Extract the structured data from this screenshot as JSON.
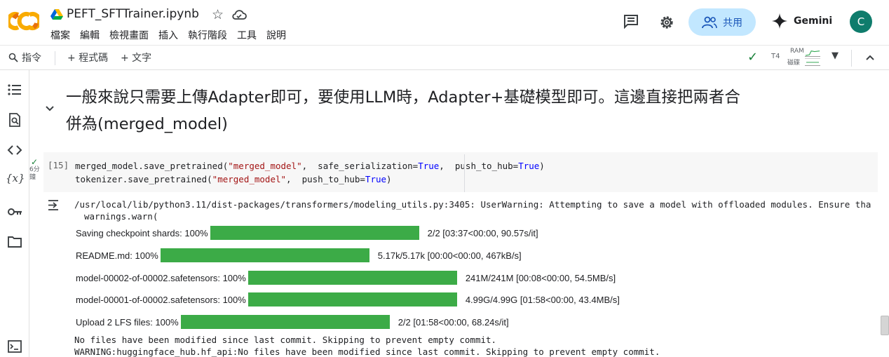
{
  "header": {
    "title": "PEFT_SFTTrainer.ipynb",
    "menu": [
      "檔案",
      "編輯",
      "檢視畫面",
      "插入",
      "執行階段",
      "工具",
      "說明"
    ],
    "share_label": "共用",
    "gemini_label": "Gemini",
    "avatar_letter": "C",
    "colors": {
      "accent": "#c2e7ff",
      "avatar": "#0f7c6c"
    }
  },
  "toolbar": {
    "commands_label": "指令",
    "code_label": "+ 程式碼",
    "text_label": "+ 文字",
    "runtime_type": "T4",
    "ram_label": "RAM",
    "disk_label": "磁碟"
  },
  "sidebar": {
    "icons": [
      "table-of-contents-icon",
      "find-replace-icon",
      "code-snippets-icon",
      "variables-icon",
      "secrets-key-icon",
      "files-folder-icon",
      "terminal-icon"
    ],
    "variables_glyph": "{x}"
  },
  "markdown": {
    "heading": "一般來說只需要上傳Adapter即可，要使用LLM時，Adapter+基礎模型即可。這邊直接把兩者合併為(merged_model)"
  },
  "cell": {
    "exec_count": "[15]",
    "exec_time": "6分鐘",
    "code": {
      "line1": [
        "merged_model.save_pretrained(",
        "\"merged_model\"",
        ",  safe_serialization=",
        "True",
        ",  push_to_hub=",
        "True",
        ")"
      ],
      "line2": [
        "tokenizer.save_pretrained(",
        "\"merged_model\"",
        ",  push_to_hub=",
        "True",
        ")"
      ]
    }
  },
  "output": {
    "warning_line": "/usr/local/lib/python3.11/dist-packages/transformers/modeling_utils.py:3405: UserWarning: Attempting to save a model with offloaded modules. Ensure tha",
    "warning_line2": "warnings.warn(",
    "progress": [
      {
        "label": "Saving checkpoint shards: 100%",
        "fraction": 1.0,
        "stats": "2/2  [03:37<00:00,  90.57s/it]"
      },
      {
        "label": "README.md: 100%",
        "fraction": 1.0,
        "stats": "5.17k/5.17k  [00:00<00:00,  467kB/s]"
      },
      {
        "label": "model-00002-of-00002.safetensors: 100%",
        "fraction": 1.0,
        "stats": "241M/241M  [00:08<00:00,  54.5MB/s]"
      },
      {
        "label": "model-00001-of-00002.safetensors: 100%",
        "fraction": 1.0,
        "stats": "4.99G/4.99G  [01:58<00:00,  43.4MB/s]"
      },
      {
        "label": "Upload  2  LFS  files: 100%",
        "fraction": 1.0,
        "stats": "2/2  [01:58<00:00,  68.24s/it]"
      }
    ],
    "log_line1": "No files have been modified since last commit. Skipping to prevent empty commit.",
    "log_line2": "WARNING:huggingface_hub.hf_api:No files have been modified since last commit. Skipping to prevent empty commit.",
    "bar_color": "#3cab47"
  }
}
